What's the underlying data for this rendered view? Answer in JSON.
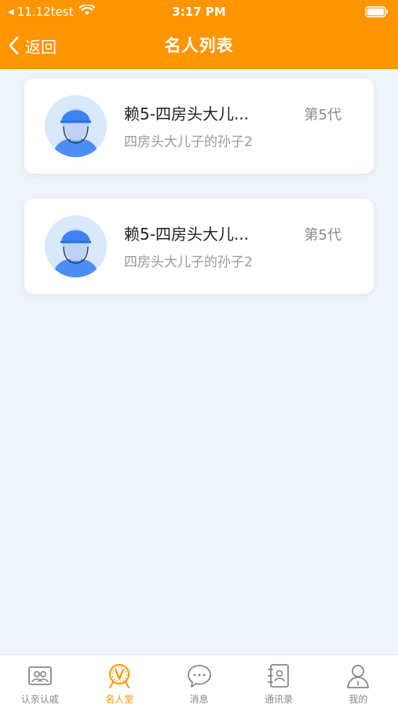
{
  "status_bar": {
    "carrier": "11.12test",
    "time": "3:17 PM"
  },
  "nav": {
    "back_label": "返回",
    "title": "名人列表"
  },
  "cards": [
    {
      "name": "赖5-四房头大儿...",
      "generation": "第5代",
      "description": "四房头大儿子的孙子2"
    },
    {
      "name": "赖5-四房头大儿...",
      "generation": "第5代",
      "description": "四房头大儿子的孙子2"
    }
  ],
  "tabbar": {
    "items": [
      {
        "label": "认亲认戚",
        "icon": "family-icon",
        "active": false
      },
      {
        "label": "名人堂",
        "icon": "celebrity-medal-icon",
        "active": true
      },
      {
        "label": "消息",
        "icon": "chat-bubble-icon",
        "active": false
      },
      {
        "label": "通讯录",
        "icon": "contacts-book-icon",
        "active": false
      },
      {
        "label": "我的",
        "icon": "person-icon",
        "active": false
      }
    ]
  },
  "colors": {
    "accent": "#ff9500",
    "background": "#eff3fa",
    "tab_inactive": "#888888"
  }
}
